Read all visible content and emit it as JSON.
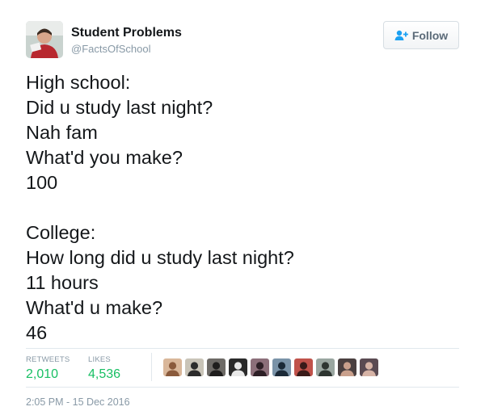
{
  "author": {
    "display_name": "Student Problems",
    "handle": "@FactsOfSchool",
    "avatar_icon": "profile-photo-icon"
  },
  "follow_button": {
    "label": "Follow",
    "icon": "add-user-icon",
    "color": "#5b6a78"
  },
  "tweet": {
    "lines": [
      "High school:",
      "Did u study last night?",
      "Nah fam",
      "What'd you make?",
      "100",
      "",
      "College:",
      "How long did u study last night?",
      "11 hours",
      "What'd u make?",
      "46"
    ]
  },
  "stats": {
    "retweets_label": "RETWEETS",
    "retweets_count": "2,010",
    "likes_label": "LIKES",
    "likes_count": "4,536",
    "count_color": "#17bf63"
  },
  "likers": [
    {
      "icon": "liker-avatar-icon",
      "bg": "#d9b79a",
      "fg": "#8a5a3c"
    },
    {
      "icon": "liker-avatar-icon",
      "bg": "#c9c4b8",
      "fg": "#2c2c2c"
    },
    {
      "icon": "liker-avatar-icon",
      "bg": "#6d6a66",
      "fg": "#1f1e1d"
    },
    {
      "icon": "liker-avatar-icon",
      "bg": "#2a2a2a",
      "fg": "#e8e8e8"
    },
    {
      "icon": "liker-avatar-icon",
      "bg": "#8c6f7a",
      "fg": "#2d1f26"
    },
    {
      "icon": "liker-avatar-icon",
      "bg": "#7a93a8",
      "fg": "#1b2a38"
    },
    {
      "icon": "liker-avatar-icon",
      "bg": "#c0524a",
      "fg": "#3a1b19"
    },
    {
      "icon": "liker-avatar-icon",
      "bg": "#9aa6a0",
      "fg": "#2e3531"
    },
    {
      "icon": "liker-avatar-icon",
      "bg": "#4a4040",
      "fg": "#c9a08c"
    },
    {
      "icon": "liker-avatar-icon",
      "bg": "#5a4a52",
      "fg": "#d6b3a6"
    }
  ],
  "timestamp": "2:05 PM - 15 Dec 2016"
}
